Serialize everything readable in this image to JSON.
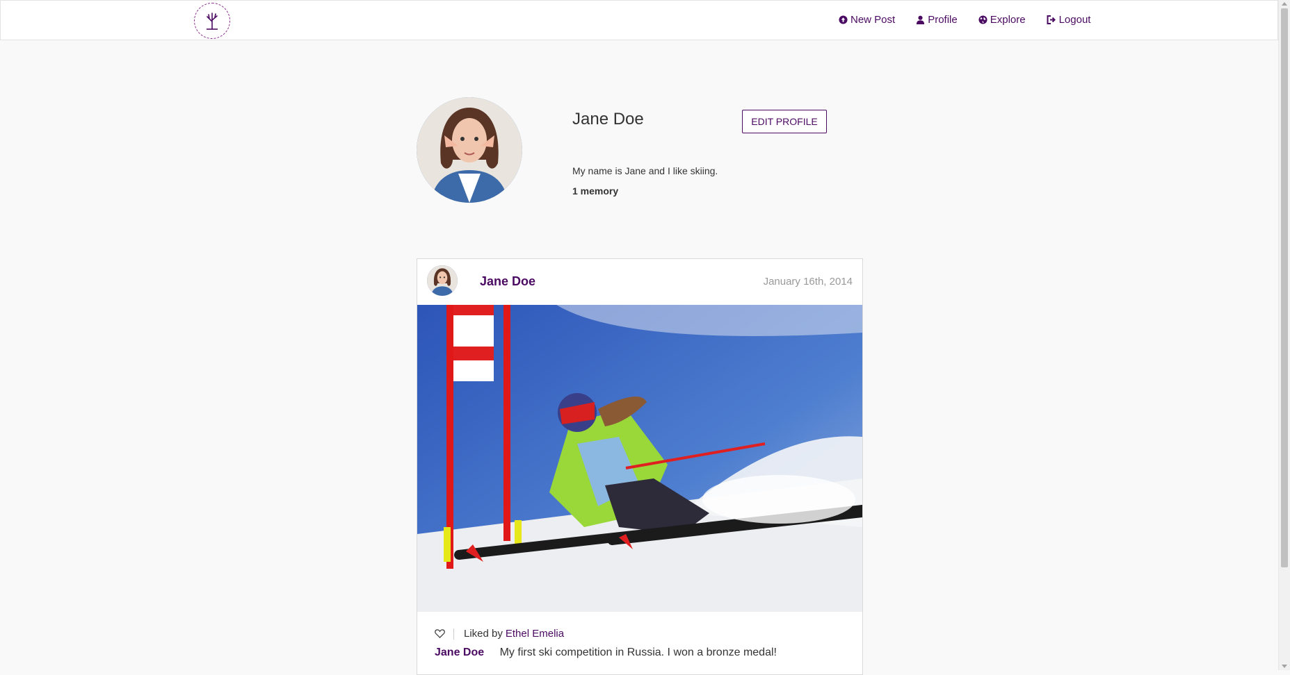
{
  "nav": {
    "links": [
      {
        "label": "New Post",
        "icon": "upload-circle-icon"
      },
      {
        "label": "Profile",
        "icon": "user-icon"
      },
      {
        "label": "Explore",
        "icon": "globe-icon"
      },
      {
        "label": "Logout",
        "icon": "logout-icon"
      }
    ]
  },
  "profile": {
    "name": "Jane Doe",
    "edit_label": "EDIT PROFILE",
    "bio": "My name is Jane and I like skiing.",
    "memory_count": "1 memory"
  },
  "post": {
    "author": "Jane Doe",
    "date": "January 16th, 2014",
    "liked_by_prefix": "Liked by",
    "liked_by_name": "Ethel Emelia",
    "caption_author": "Jane Doe",
    "caption": "My first ski competition in Russia. I won a bronze medal!"
  },
  "colors": {
    "accent": "#4b0a62",
    "background": "#f9f9f9"
  }
}
